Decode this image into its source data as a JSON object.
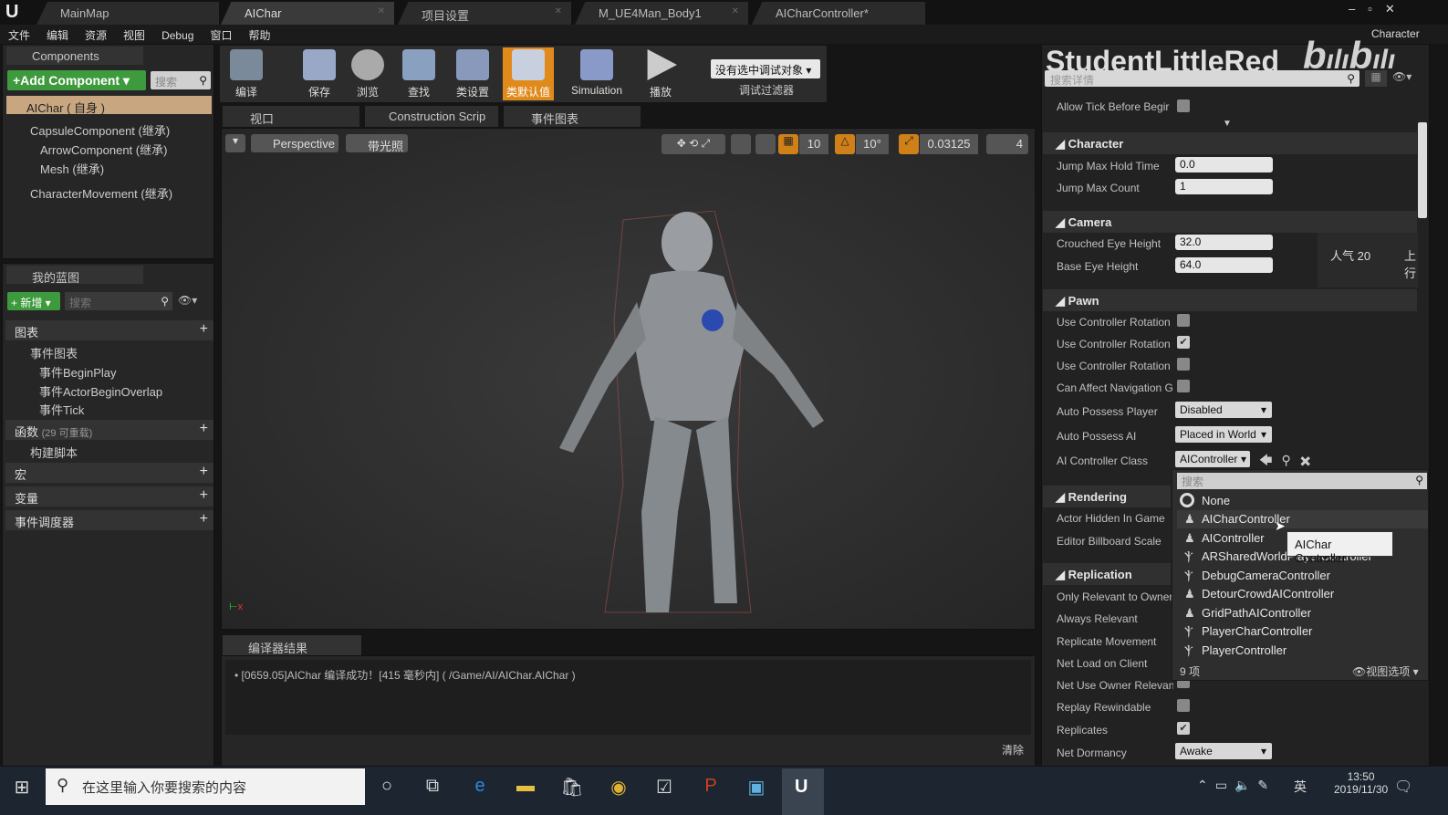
{
  "titlebar": {
    "tabs": [
      "MainMap",
      "AIChar",
      "项目设置",
      "M_UE4Man_Body1",
      "AICharController*"
    ],
    "right_label": "Character"
  },
  "menu": [
    "文件",
    "编辑",
    "资源",
    "视图",
    "Debug",
    "窗口",
    "帮助"
  ],
  "components": {
    "title": "Components",
    "add_label": "+Add Component ▾",
    "search_placeholder": "搜索",
    "root": "AIChar ( 自身 )",
    "items": [
      "CapsuleComponent (继承)",
      "ArrowComponent (继承)",
      "Mesh (继承)",
      "CharacterMovement (继承)"
    ]
  },
  "toolbar": {
    "buttons": [
      "编译",
      "保存",
      "浏览",
      "查找",
      "类设置",
      "类默认值",
      "Simulation",
      "播放"
    ],
    "debug_select": "没有选中调试对象 ▾",
    "debug_label": "调试过滤器"
  },
  "editor_tabs": [
    "视口",
    "Construction Scrip",
    "事件图表"
  ],
  "viewport": {
    "mode": "Perspective",
    "lighting": "带光照",
    "grid": "10",
    "angle": "10°",
    "scale": "0.03125",
    "camera_speed": "4"
  },
  "my_blueprint": {
    "title": "我的蓝图",
    "new_label": "+ 新增 ▾",
    "search_placeholder": "搜索",
    "graphs": "图表",
    "event_graph": "事件图表",
    "events": [
      "事件BeginPlay",
      "事件ActorBeginOverlap",
      "事件Tick"
    ],
    "functions": "函数",
    "functions_count": "(29 可重载)",
    "construction": "构建脚本",
    "macros": "宏",
    "variables": "变量",
    "dispatchers": "事件调度器"
  },
  "compiler": {
    "tab": "编译器结果",
    "message": "[0659.05]AIChar 编译成功！[415 毫秒内] ( /Game/AI/AIChar.AIChar )",
    "clear": "清除"
  },
  "details": {
    "watermark": "StudentLittleRed",
    "watermark_logo": "bilibili",
    "search_placeholder": "搜索详情",
    "allow_tick": "Allow Tick Before Begir",
    "character": {
      "title": "Character",
      "jump_hold_label": "Jump Max Hold Time",
      "jump_hold": "0.0",
      "jump_count_label": "Jump Max Count",
      "jump_count": "1"
    },
    "camera": {
      "title": "Camera",
      "crouched_label": "Crouched Eye Height",
      "crouched": "32.0",
      "base_label": "Base Eye Height",
      "base": "64.0"
    },
    "overlay": {
      "popularity": "人气 20",
      "up": "上行"
    },
    "pawn": {
      "title": "Pawn",
      "rows": [
        "Use Controller Rotation",
        "Use Controller Rotation",
        "Use Controller Rotation",
        "Can Affect Navigation G"
      ],
      "checked": [
        false,
        true,
        false,
        false
      ],
      "auto_player_label": "Auto Possess Player",
      "auto_player": "Disabled",
      "auto_ai_label": "Auto Possess AI",
      "auto_ai": "Placed in World",
      "ai_class_label": "AI Controller Class",
      "ai_class": "AIController"
    },
    "rendering": {
      "title": "Rendering",
      "rows": [
        "Actor Hidden In Game",
        "Editor Billboard Scale"
      ]
    },
    "replication": {
      "title": "Replication",
      "rows": [
        "Only Relevant to Owner",
        "Always Relevant",
        "Replicate Movement",
        "Net Load on Client",
        "Net Use Owner Relevan",
        "Replay Rewindable",
        "Replicates",
        "Net Dormancy"
      ],
      "dormancy": "Awake"
    }
  },
  "dropdown": {
    "search_placeholder": "搜索",
    "items": [
      "None",
      "AICharController",
      "AIController",
      "ARSharedWorldPlayerController",
      "DebugCameraController",
      "DetourCrowdAIController",
      "GridPathAIController",
      "PlayerCharController",
      "PlayerController"
    ],
    "count": "9 项",
    "view_options": "视图选项 ▾",
    "tooltip": "AIChar Controller"
  },
  "taskbar": {
    "search_placeholder": "在这里输入你要搜索的内容",
    "ime": "英",
    "time": "13:50",
    "date": "2019/11/30"
  }
}
